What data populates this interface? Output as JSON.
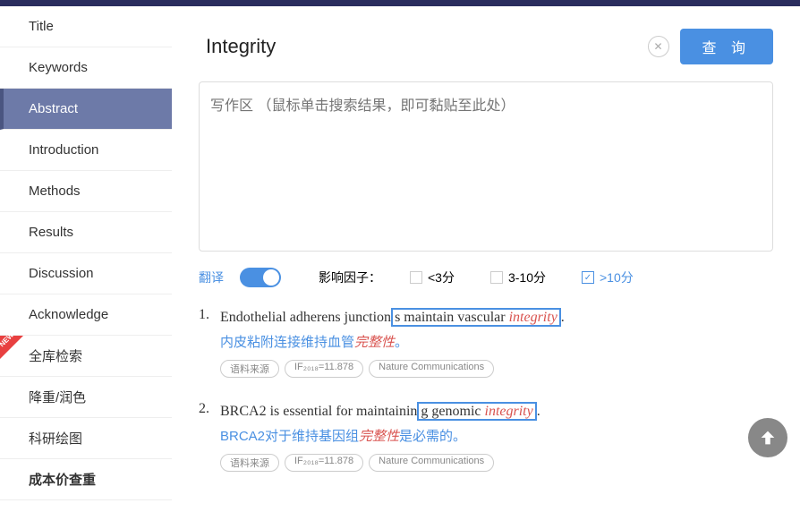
{
  "sidebar": {
    "items": [
      {
        "label": "Title"
      },
      {
        "label": "Keywords"
      },
      {
        "label": "Abstract"
      },
      {
        "label": "Introduction"
      },
      {
        "label": "Methods"
      },
      {
        "label": "Results"
      },
      {
        "label": "Discussion"
      },
      {
        "label": "Acknowledge"
      },
      {
        "label": "全库检索"
      },
      {
        "label": "降重/润色"
      },
      {
        "label": "科研绘图"
      },
      {
        "label": "成本价查重"
      }
    ],
    "new_badge": "NEW"
  },
  "search": {
    "value": "Integrity"
  },
  "buttons": {
    "query": "查 询"
  },
  "write_area": {
    "placeholder": "写作区 （鼠标单击搜索结果，即可黏贴至此处）"
  },
  "filters": {
    "translate_label": "翻译",
    "if_label": "影响因子：",
    "opt1": "<3分",
    "opt2": "3-10分",
    "opt3": ">10分"
  },
  "results": [
    {
      "num": "1.",
      "sent_pre": "Endothelial adherens junction",
      "sent_box": "s maintain vascular ",
      "sent_em": "integrity",
      "sent_post": ".",
      "trans_pre": "内皮粘附连接维持血管",
      "trans_em": "完整性",
      "trans_post": "。",
      "tag1": "语料来源",
      "tag2": "IF₂₀₁₈=11.878",
      "tag3": "Nature Communications"
    },
    {
      "num": "2.",
      "sent_pre": "BRCA2 is essential for maintainin",
      "sent_box": "g genomic ",
      "sent_em": "integrity",
      "sent_post": ".",
      "trans_pre": "BRCA2对于维持基因组",
      "trans_em": "完整性",
      "trans_post": "是必需的。",
      "tag1": "语料来源",
      "tag2": "IF₂₀₁₈=11.878",
      "tag3": "Nature Communications"
    }
  ]
}
